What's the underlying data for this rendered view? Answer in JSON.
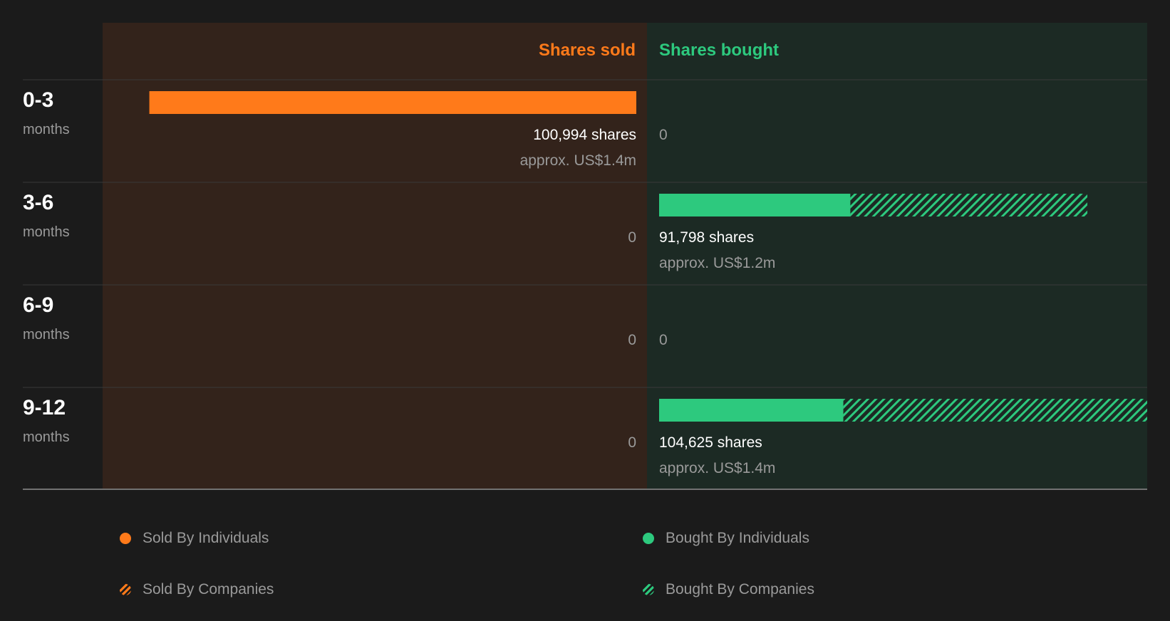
{
  "chart_data": {
    "type": "bar",
    "columns": {
      "sold": {
        "label": "Shares sold",
        "color": "#ff7a1a"
      },
      "bought": {
        "label": "Shares bought",
        "color": "#2dc97e"
      }
    },
    "categories": [
      {
        "range": "0-3",
        "unit": "months"
      },
      {
        "range": "3-6",
        "unit": "months"
      },
      {
        "range": "6-9",
        "unit": "months"
      },
      {
        "range": "9-12",
        "unit": "months"
      }
    ],
    "sold": [
      {
        "shares": 100994,
        "individuals": 100994,
        "companies": 0,
        "label": "100,994 shares",
        "approx": "approx. US$1.4m"
      },
      {
        "shares": 0,
        "individuals": 0,
        "companies": 0,
        "label": "0",
        "approx": ""
      },
      {
        "shares": 0,
        "individuals": 0,
        "companies": 0,
        "label": "0",
        "approx": ""
      },
      {
        "shares": 0,
        "individuals": 0,
        "companies": 0,
        "label": "0",
        "approx": ""
      }
    ],
    "bought": [
      {
        "shares": 0,
        "individuals": 0,
        "companies": 0,
        "label": "0",
        "approx": ""
      },
      {
        "shares": 91798,
        "individuals": 41000,
        "companies": 50798,
        "label": "91,798 shares",
        "approx": "approx. US$1.2m"
      },
      {
        "shares": 0,
        "individuals": 0,
        "companies": 0,
        "label": "0",
        "approx": ""
      },
      {
        "shares": 104625,
        "individuals": 39500,
        "companies": 65125,
        "label": "104,625 shares",
        "approx": "approx. US$1.4m"
      }
    ],
    "max_shares": 104625
  },
  "legend": {
    "sold_individuals": "Sold By Individuals",
    "bought_individuals": "Bought By Individuals",
    "sold_companies": "Sold By Companies",
    "bought_companies": "Bought By Companies"
  },
  "colors": {
    "background": "#1b1b1b",
    "sold_panel": "#33231b",
    "bought_panel": "#1c2a24",
    "sold": "#ff7a1a",
    "bought": "#2dc97e",
    "label_primary": "#ffffff",
    "label_secondary": "#9a9a9a"
  }
}
